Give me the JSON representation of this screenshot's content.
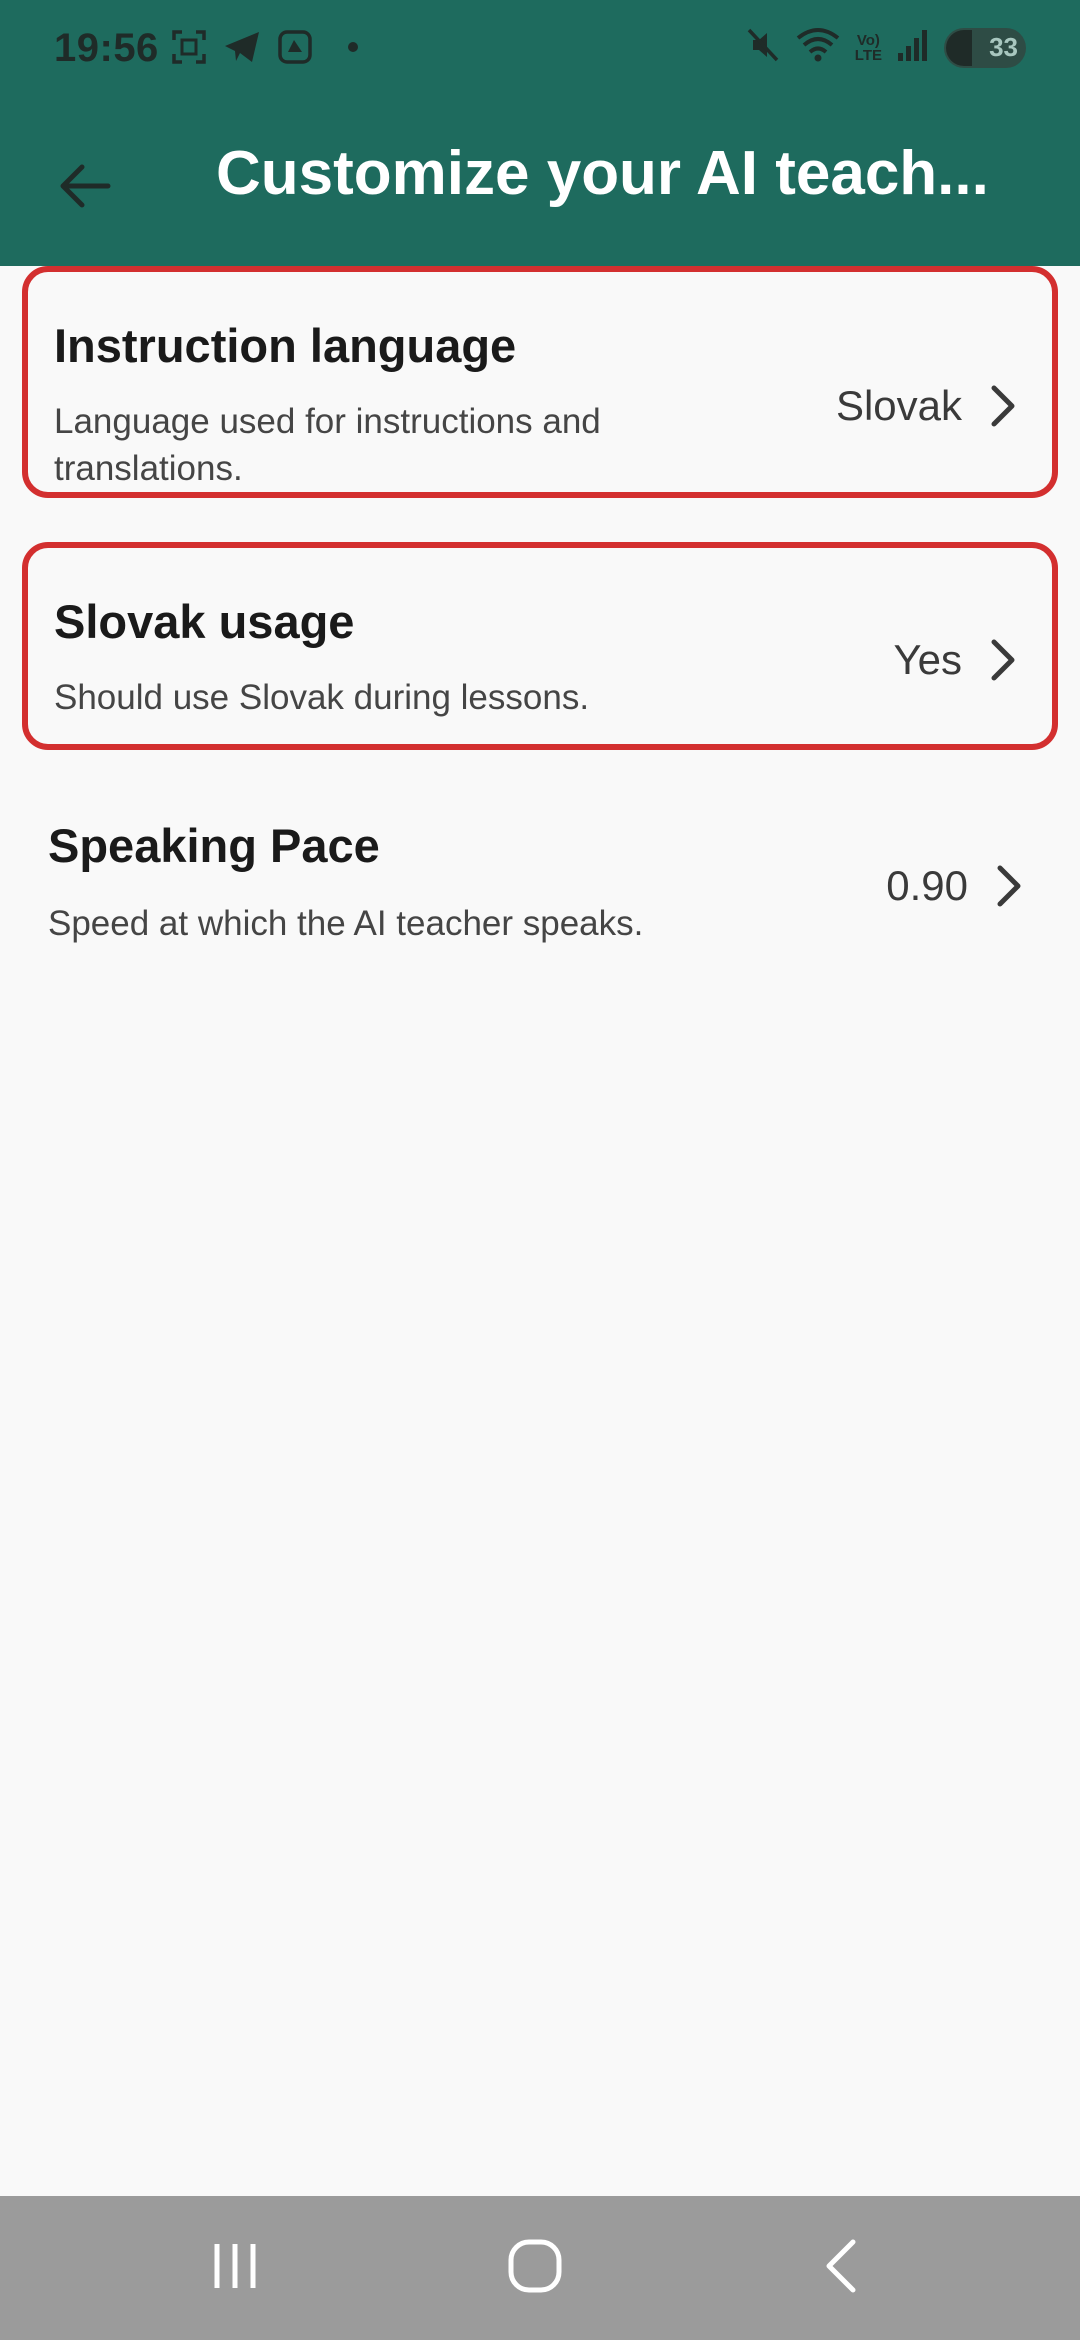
{
  "status_bar": {
    "time": "19:56",
    "battery": "33",
    "network_label_top": "Vo)",
    "network_label_bottom": "LTE"
  },
  "app_bar": {
    "title": "Customize your AI teach..."
  },
  "settings": [
    {
      "title": "Instruction language",
      "description": "Language used for instructions and translations.",
      "value": "Slovak"
    },
    {
      "title": "Slovak usage",
      "description": "Should use Slovak during lessons.",
      "value": "Yes"
    },
    {
      "title": "Speaking Pace",
      "description": "Speed at which the AI teacher speaks.",
      "value": "0.90"
    }
  ],
  "colors": {
    "app_bar": "#1e6b5e",
    "highlight_border": "#d32f2f",
    "background": "#f9f9f9",
    "nav_bar": "#9b9b9b"
  },
  "icons": {
    "back": "arrow-left-icon",
    "chevron": "chevron-right-icon",
    "nav_recents": "recents-icon",
    "nav_home": "home-icon",
    "nav_back": "back-icon"
  }
}
